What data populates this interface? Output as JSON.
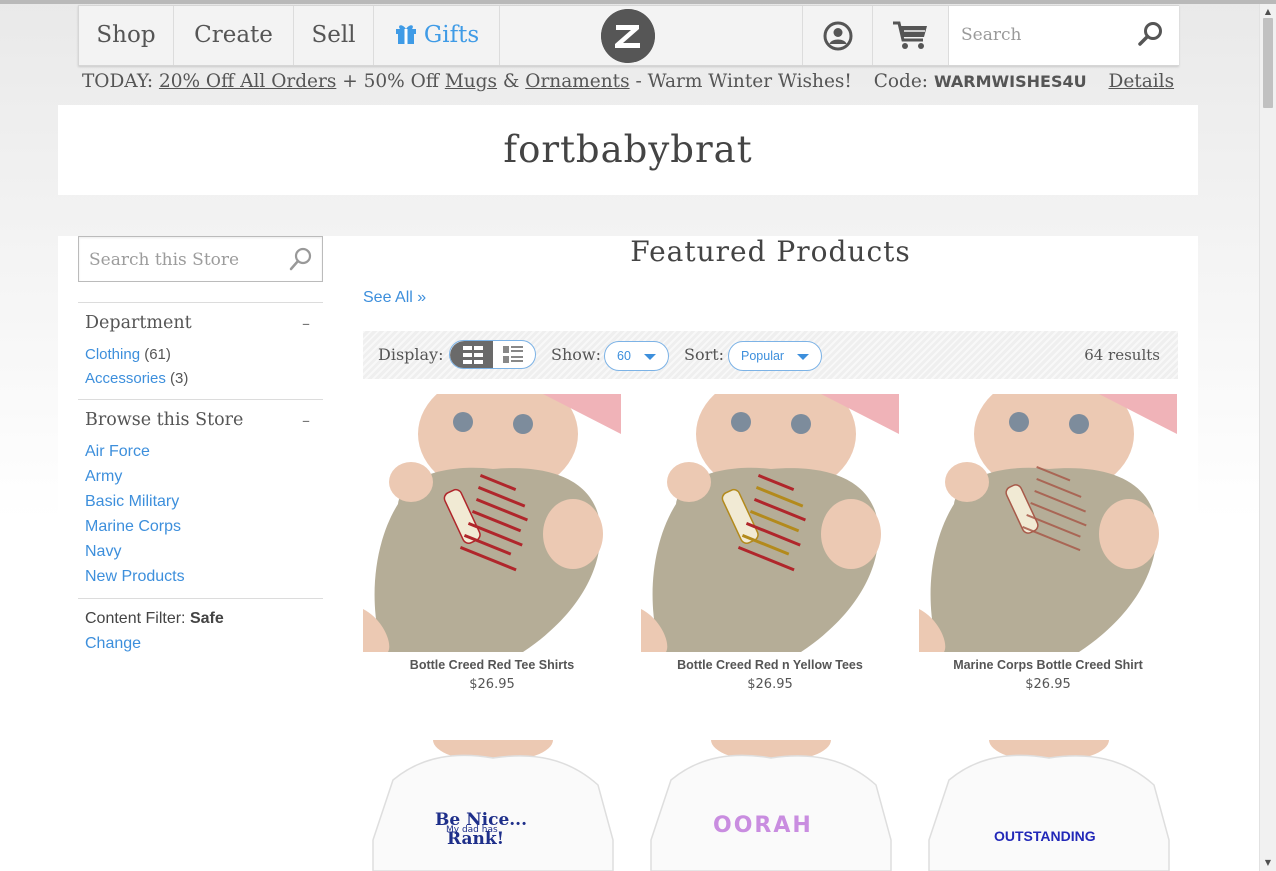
{
  "header": {
    "nav": [
      "Shop",
      "Create",
      "Sell",
      "Gifts"
    ],
    "search_placeholder": "Search"
  },
  "promo": {
    "prefix": "TODAY:",
    "offer1": "20% Off All Orders",
    "mid1": "+ 50% Off",
    "mugs": "Mugs",
    "amp": "&",
    "ornaments": "Ornaments",
    "suffix": "- Warm Winter Wishes!",
    "code_label": "Code:",
    "code": "WARMWISHES4U",
    "details": "Details"
  },
  "store": {
    "title": "fortbabybrat"
  },
  "sidebar": {
    "search_placeholder": "Search this Store",
    "department": {
      "heading": "Department",
      "toggle": "–",
      "items": [
        {
          "label": "Clothing",
          "count": "(61)"
        },
        {
          "label": "Accessories",
          "count": "(3)"
        }
      ]
    },
    "browse": {
      "heading": "Browse this Store",
      "toggle": "–",
      "items": [
        "Air Force",
        "Army",
        "Basic Military",
        "Marine Corps",
        "Navy",
        "New Products"
      ]
    },
    "filter": {
      "label": "Content Filter:",
      "value": "Safe",
      "change": "Change"
    }
  },
  "main": {
    "title": "Featured Products",
    "see_all": "See All »",
    "toolbar": {
      "display_label": "Display:",
      "show_label": "Show:",
      "show_value": "60",
      "sort_label": "Sort:",
      "sort_value": "Popular",
      "results": "64 results"
    },
    "products": [
      {
        "name": "Bottle Creed Red Tee Shirts",
        "price": "$26.95",
        "text_color": "#b0262b"
      },
      {
        "name": "Bottle Creed Red n Yellow Tees",
        "price": "$26.95",
        "text_color": "#b38a1c"
      },
      {
        "name": "Marine Corps Bottle Creed Shirt",
        "price": "$26.95",
        "text_color": "#a85a4a"
      }
    ],
    "products_row2": [
      {
        "line1": "Be Nice...",
        "line2": "My dad has",
        "line3": "Rank!"
      },
      {
        "line1": "OORAH"
      },
      {
        "line1": "OUTSTANDING"
      }
    ]
  },
  "colors": {
    "link": "#3d8fdc",
    "gifts": "#3f9be6",
    "onesie": "#b5ad97",
    "tee": "#ffffff"
  }
}
